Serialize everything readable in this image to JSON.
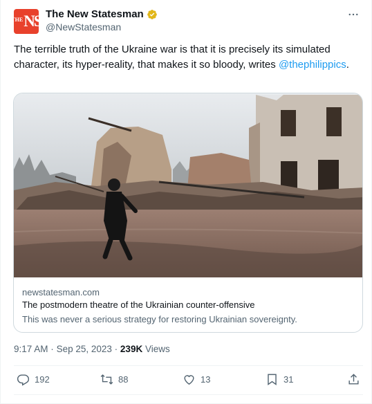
{
  "author": {
    "name": "The New Statesman",
    "handle": "@NewStatesman",
    "avatar_text_small": "THE",
    "avatar_text_big": "NS",
    "verified_icon": "gold-verified-badge"
  },
  "tweet": {
    "text_before": "The terrible truth of the Ukraine war is that it is precisely its simulated character, its hyper-reality, that makes it so bloody, writes ",
    "mention": "@thephilippics",
    "text_after": "."
  },
  "card": {
    "domain": "newstatesman.com",
    "title": "The postmodern theatre of the Ukrainian counter-offensive",
    "description": "This was never a serious strategy for restoring Ukrainian sovereignty."
  },
  "meta": {
    "time": "9:17 AM",
    "separator": "·",
    "date": "Sep 25, 2023",
    "views_count": "239K",
    "views_label": "Views"
  },
  "actions": {
    "replies": "192",
    "reposts": "88",
    "likes": "13",
    "bookmarks": "31"
  },
  "colors": {
    "accent": "#1d9bf0",
    "muted": "#536471",
    "avatar_bg": "#e8412c",
    "verified": "#e2b719"
  }
}
